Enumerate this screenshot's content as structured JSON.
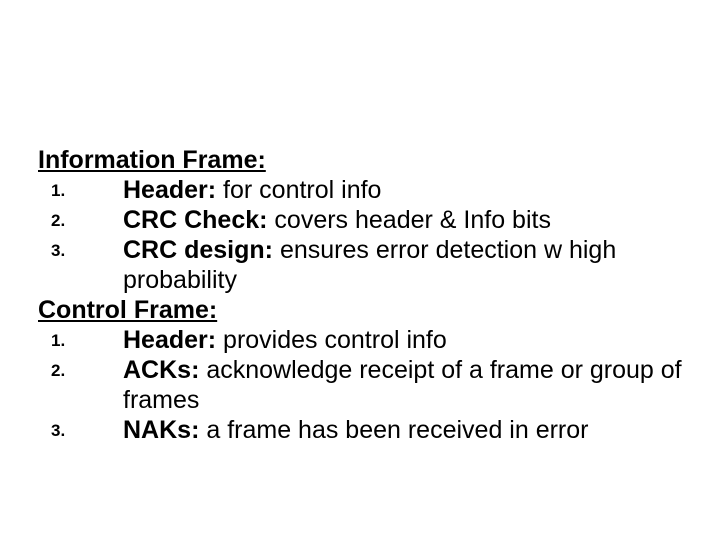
{
  "section1": {
    "heading": "Information Frame:",
    "items": [
      {
        "num": "1.",
        "term": "Header: ",
        "rest": "for  control info"
      },
      {
        "num": "2.",
        "term": "CRC Check: ",
        "rest": "covers header & Info bits"
      },
      {
        "num": "3.",
        "term": "CRC design: ",
        "rest": "ensures error detection w high probability"
      }
    ]
  },
  "section2": {
    "heading": "Control Frame:",
    "items": [
      {
        "num": "1.",
        "term": "Header: ",
        "rest": "provides control info"
      },
      {
        "num": "2.",
        "term": "ACKs: ",
        "rest": "acknowledge receipt of a frame or group of frames"
      },
      {
        "num": "3.",
        "term": "NAKs: ",
        "rest": "a frame has been received in error"
      }
    ]
  }
}
